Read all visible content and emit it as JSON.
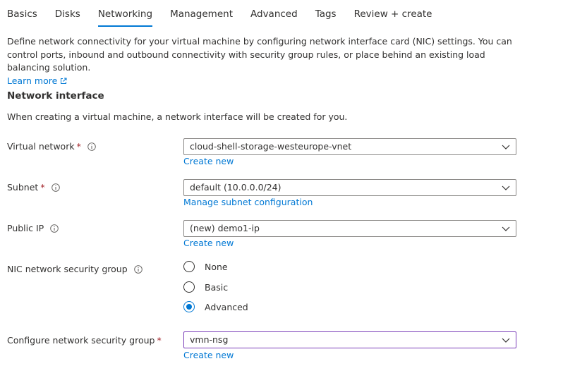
{
  "tabs": [
    {
      "label": "Basics"
    },
    {
      "label": "Disks"
    },
    {
      "label": "Networking"
    },
    {
      "label": "Management"
    },
    {
      "label": "Advanced"
    },
    {
      "label": "Tags"
    },
    {
      "label": "Review + create"
    }
  ],
  "active_tab": "Networking",
  "intro": {
    "text": "Define network connectivity for your virtual machine by configuring network interface card (NIC) settings. You can control ports, inbound and outbound connectivity with security group rules, or place behind an existing load balancing solution.",
    "learn_more": "Learn more",
    "learn_more_icon": "external-link-icon"
  },
  "section": {
    "title": "Network interface",
    "description": "When creating a virtual machine, a network interface will be created for you."
  },
  "fields": {
    "virtual_network": {
      "label": "Virtual network",
      "required": "*",
      "value": "cloud-shell-storage-westeurope-vnet",
      "link": "Create new"
    },
    "subnet": {
      "label": "Subnet",
      "required": "*",
      "value": "default (10.0.0.0/24)",
      "link": "Manage subnet configuration"
    },
    "public_ip": {
      "label": "Public IP",
      "value": "(new) demo1-ip",
      "link": "Create new"
    },
    "nic_nsg": {
      "label": "NIC network security group",
      "options": [
        "None",
        "Basic",
        "Advanced"
      ],
      "selected": "Advanced"
    },
    "configure_nsg": {
      "label": "Configure network security group",
      "required": "*",
      "value": "vmn-nsg",
      "link": "Create new"
    }
  },
  "colors": {
    "accent": "#0078d4",
    "required": "#a4262c",
    "focus_border": "#7a3db8",
    "text": "#323130"
  }
}
